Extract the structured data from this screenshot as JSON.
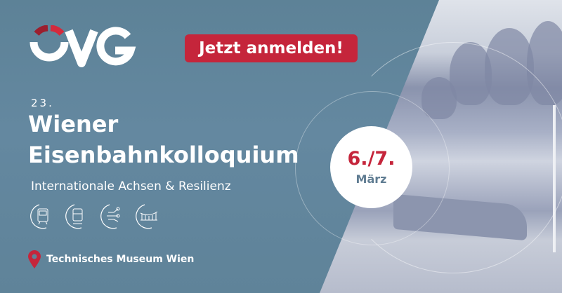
{
  "logo": {
    "text": "ÖVG"
  },
  "cta": {
    "label": "Jetzt anmelden!"
  },
  "event": {
    "edition": "23.",
    "title_line1": "Wiener",
    "title_line2": "Eisenbahnkolloquium",
    "subtitle": "Internationale Achsen & Resilienz"
  },
  "topic_icons": [
    "train-front-icon",
    "tram-icon",
    "network-nodes-icon",
    "bridge-icon"
  ],
  "location": {
    "label": "Technisches Museum Wien",
    "icon": "map-pin-icon"
  },
  "date": {
    "days": "6./7.",
    "month": "März"
  },
  "colors": {
    "accent": "#c5253b",
    "background": "#5e8399"
  }
}
